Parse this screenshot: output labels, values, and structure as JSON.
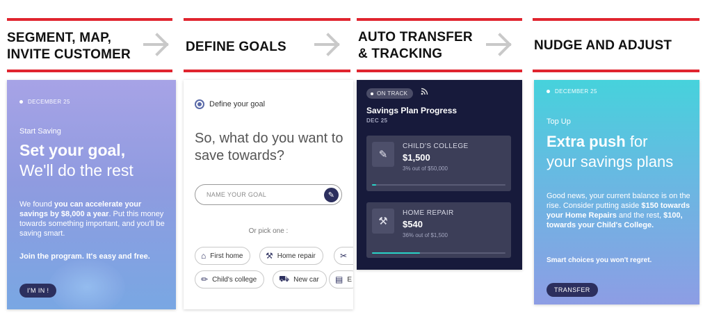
{
  "steps": [
    {
      "line1": "SEGMENT, MAP,",
      "line2": "INVITE CUSTOMER"
    },
    {
      "line1": "DEFINE GOALS",
      "line2": ""
    },
    {
      "line1": "AUTO TRANSFER",
      "line2": "& TRACKING"
    },
    {
      "line1": "NUDGE AND ADJUST",
      "line2": ""
    }
  ],
  "colors": {
    "accent_bar": "#e0252f",
    "navy": "#2c2f5e",
    "progress": "#29d3c7",
    "dark_card": "#171a3b"
  },
  "card1": {
    "date": "DECEMBER 25",
    "label": "Start Saving",
    "headline_bold": "Set your goal,",
    "headline_light": "We'll do the rest",
    "body_intro": "We found ",
    "body_bold": "you can accelerate your savings by $8,000 a year",
    "body_rest": ". Put this money towards something important, and you'll be saving smart.",
    "join": "Join the program. It's easy and free.",
    "button": "I'M IN !"
  },
  "card2": {
    "header": "Define your goal",
    "question": "So, what do you want to save towards?",
    "input_placeholder": "NAME YOUR GOAL",
    "pick": "Or pick one :",
    "chips": [
      {
        "icon": "house-icon",
        "label": "First home"
      },
      {
        "icon": "tools-icon",
        "label": "Home repair"
      },
      {
        "icon": "tools-icon",
        "label": ""
      },
      {
        "icon": "college-icon",
        "label": "Child's college"
      },
      {
        "icon": "car-icon",
        "label": "New car"
      },
      {
        "icon": "book-icon",
        "label": "E"
      }
    ]
  },
  "card3": {
    "status": "ON TRACK",
    "title": "Savings Plan Progress",
    "date": "DEC 25",
    "goals": [
      {
        "icon": "pencil-ruler-icon",
        "name": "CHILD'S COLLEGE",
        "amount": "$1,500",
        "sub": "3% out of $50,000",
        "progress": 0.03
      },
      {
        "icon": "tools-icon",
        "name": "HOME REPAIR",
        "amount": "$540",
        "sub": "36% out of $1,500",
        "progress": 0.36
      }
    ]
  },
  "card4": {
    "date": "DECEMBER 25",
    "label": "Top Up",
    "headline_bold": "Extra push",
    "headline_light_1": " for",
    "headline_light_2": "your savings plans",
    "body_1": "Good news, your current balance is on the rise. Consider putting aside ",
    "body_bold_1": "$150 towards your Home Repairs",
    "body_2": " and the rest, ",
    "body_bold_2": "$100, towards your Child's College.",
    "smart": "Smart choices you won't regret.",
    "button": "TRANSFER"
  }
}
